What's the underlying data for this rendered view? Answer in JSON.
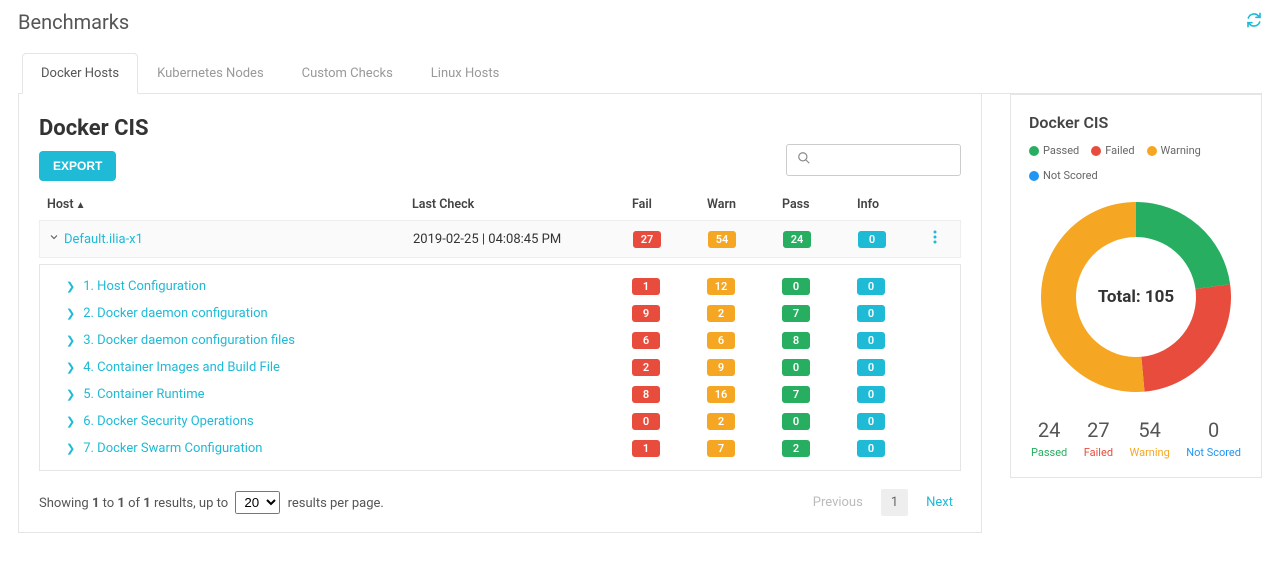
{
  "page_title": "Benchmarks",
  "tabs": [
    "Docker Hosts",
    "Kubernetes Nodes",
    "Custom Checks",
    "Linux Hosts"
  ],
  "panel_title": "Docker CIS",
  "export_label": "EXPORT",
  "search_placeholder": "",
  "columns": {
    "host": "Host",
    "last_check": "Last Check",
    "fail": "Fail",
    "warn": "Warn",
    "pass": "Pass",
    "info": "Info"
  },
  "host": {
    "name": "Default.ilia-x1",
    "last_check": "2019-02-25 | 04:08:45 PM",
    "fail": "27",
    "warn": "54",
    "pass": "24",
    "info": "0"
  },
  "sections": [
    {
      "label": "1. Host Configuration",
      "fail": "1",
      "warn": "12",
      "pass": "0",
      "info": "0"
    },
    {
      "label": "2. Docker daemon configuration",
      "fail": "9",
      "warn": "2",
      "pass": "7",
      "info": "0"
    },
    {
      "label": "3. Docker daemon configuration files",
      "fail": "6",
      "warn": "6",
      "pass": "8",
      "info": "0"
    },
    {
      "label": "4. Container Images and Build File",
      "fail": "2",
      "warn": "9",
      "pass": "0",
      "info": "0"
    },
    {
      "label": "5. Container Runtime",
      "fail": "8",
      "warn": "16",
      "pass": "7",
      "info": "0"
    },
    {
      "label": "6. Docker Security Operations",
      "fail": "0",
      "warn": "2",
      "pass": "0",
      "info": "0"
    },
    {
      "label": "7. Docker Swarm Configuration",
      "fail": "1",
      "warn": "7",
      "pass": "2",
      "info": "0"
    }
  ],
  "pager": {
    "text_pre": "Showing ",
    "from": "1",
    "to": "1",
    "of_txt": " of ",
    "total": "1",
    "text_mid": " results, up to ",
    "per_page": "20",
    "text_post": " results per page.",
    "prev": "Previous",
    "page": "1",
    "next": "Next",
    "to_sep": " to "
  },
  "side": {
    "title": "Docker CIS",
    "legend": {
      "passed": "Passed",
      "failed": "Failed",
      "warning": "Warning",
      "not_scored": "Not Scored"
    },
    "total_label": "Total: 105",
    "stats": {
      "passed": "24",
      "failed": "27",
      "warning": "54",
      "not_scored": "0"
    }
  },
  "chart_data": {
    "type": "pie",
    "title": "Docker CIS",
    "series": [
      {
        "name": "Passed",
        "value": 24,
        "color": "#27ae60"
      },
      {
        "name": "Failed",
        "value": 27,
        "color": "#e84c3d"
      },
      {
        "name": "Warning",
        "value": 54,
        "color": "#f5a623"
      },
      {
        "name": "Not Scored",
        "value": 0,
        "color": "#2196f3"
      }
    ],
    "total": 105,
    "donut": true
  }
}
